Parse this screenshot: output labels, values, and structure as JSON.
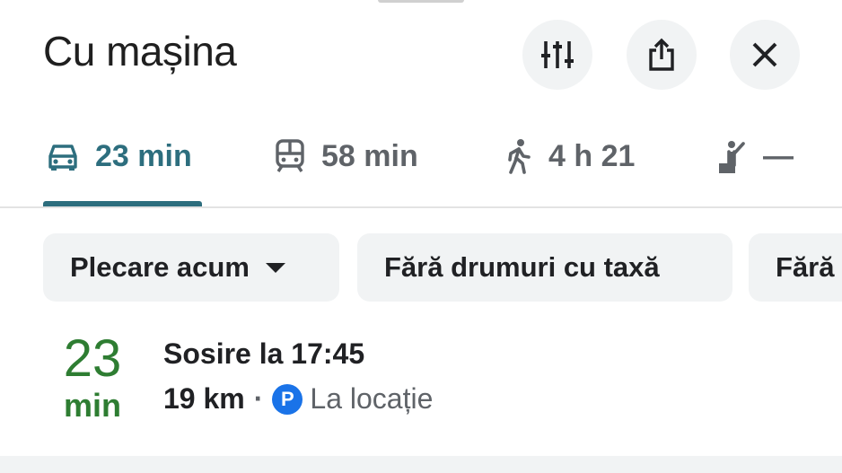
{
  "header": {
    "title": "Cu mașina",
    "buttons": [
      {
        "name": "route-options",
        "icon": "sliders-icon"
      },
      {
        "name": "share",
        "icon": "share-icon"
      },
      {
        "name": "close",
        "icon": "close-icon"
      }
    ]
  },
  "modes": {
    "active_color": "#2d6e7e",
    "items": [
      {
        "mode": "car",
        "icon": "car-icon",
        "label": "23 min",
        "selected": true
      },
      {
        "mode": "transit",
        "icon": "train-icon",
        "label": "58 min",
        "selected": false
      },
      {
        "mode": "walk",
        "icon": "walking-icon",
        "label": "4 h 21",
        "selected": false
      },
      {
        "mode": "ride",
        "icon": "ride-hail-icon",
        "label": "—",
        "selected": false
      }
    ]
  },
  "filters": {
    "chips": [
      {
        "label": "Plecare acum",
        "has_dropdown": true
      },
      {
        "label": "Fără drumuri cu taxă",
        "has_dropdown": false
      },
      {
        "label": "Fără",
        "has_dropdown": false
      }
    ]
  },
  "route": {
    "duration_value": "23",
    "duration_unit": "min",
    "arrival": "Sosire la 17:45",
    "distance": "19 km",
    "separator": "·",
    "parking_badge": "P",
    "parking_text": "La locație",
    "duration_color": "#2e7d32",
    "parking_color": "#1a73e8"
  }
}
